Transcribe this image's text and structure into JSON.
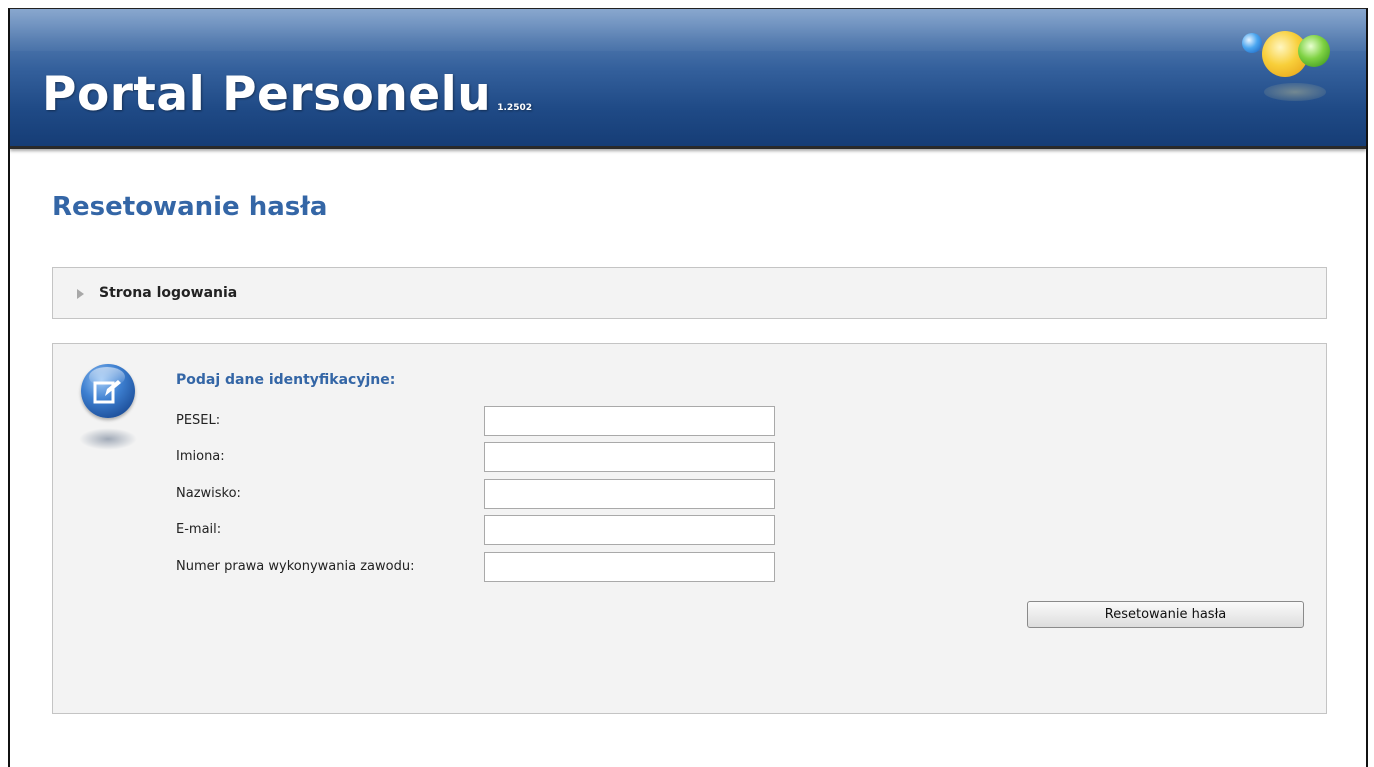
{
  "header": {
    "app_title": "Portal Personelu",
    "version": "1.2502",
    "logo_icon": "colored-balls-logo",
    "colors": {
      "header_dark": "#163d76",
      "header_light": "#6f94c4"
    }
  },
  "page": {
    "title": "Resetowanie hasła",
    "title_color": "#3466a6"
  },
  "nav": {
    "link_label": "Strona logowania",
    "arrow_icon": "triangle-right-icon"
  },
  "form": {
    "icon": "edit-form-icon",
    "heading": "Podaj dane identyfikacyjne:",
    "fields": [
      {
        "label": "PESEL:",
        "value": "",
        "placeholder": ""
      },
      {
        "label": "Imiona:",
        "value": "",
        "placeholder": ""
      },
      {
        "label": "Nazwisko:",
        "value": "",
        "placeholder": ""
      },
      {
        "label": "E-mail:",
        "value": "",
        "placeholder": ""
      },
      {
        "label": "Numer prawa wykonywania zawodu:",
        "value": "",
        "placeholder": ""
      }
    ],
    "submit_label": "Resetowanie hasła"
  }
}
